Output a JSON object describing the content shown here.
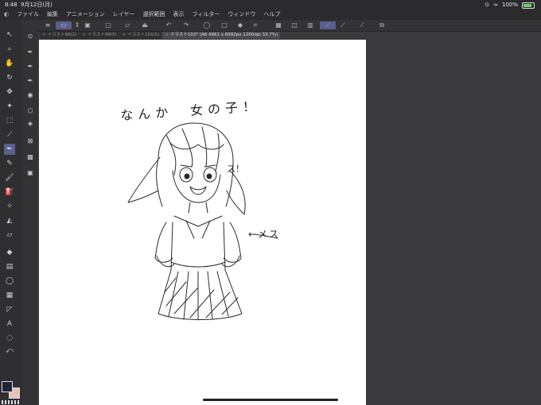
{
  "status": {
    "time": "8:48",
    "date": "9月12日(月)",
    "battery": "100%"
  },
  "menu": {
    "items": [
      "ファイル",
      "編集",
      "アニメーション",
      "レイヤー",
      "選択範囲",
      "表示",
      "フィルター",
      "ウィンドウ",
      "ヘルプ"
    ]
  },
  "tabs": [
    {
      "label": "イラスト96(2)",
      "active": false
    },
    {
      "label": "イラスト99(5)",
      "active": false
    },
    {
      "label": "イラスト101(5)",
      "active": false
    },
    {
      "label": "イラスト102* (A6 4961 x 6992px 1200dpi 33.7%)",
      "active": true
    }
  ],
  "canvas_text": {
    "title": "なんか　女の子！",
    "arrow_note": "←メス",
    "exclaim": "ス！"
  },
  "colors": {
    "main": "#1d2438",
    "sub": "#e5c3bb",
    "accent": "#5b5f8f"
  }
}
